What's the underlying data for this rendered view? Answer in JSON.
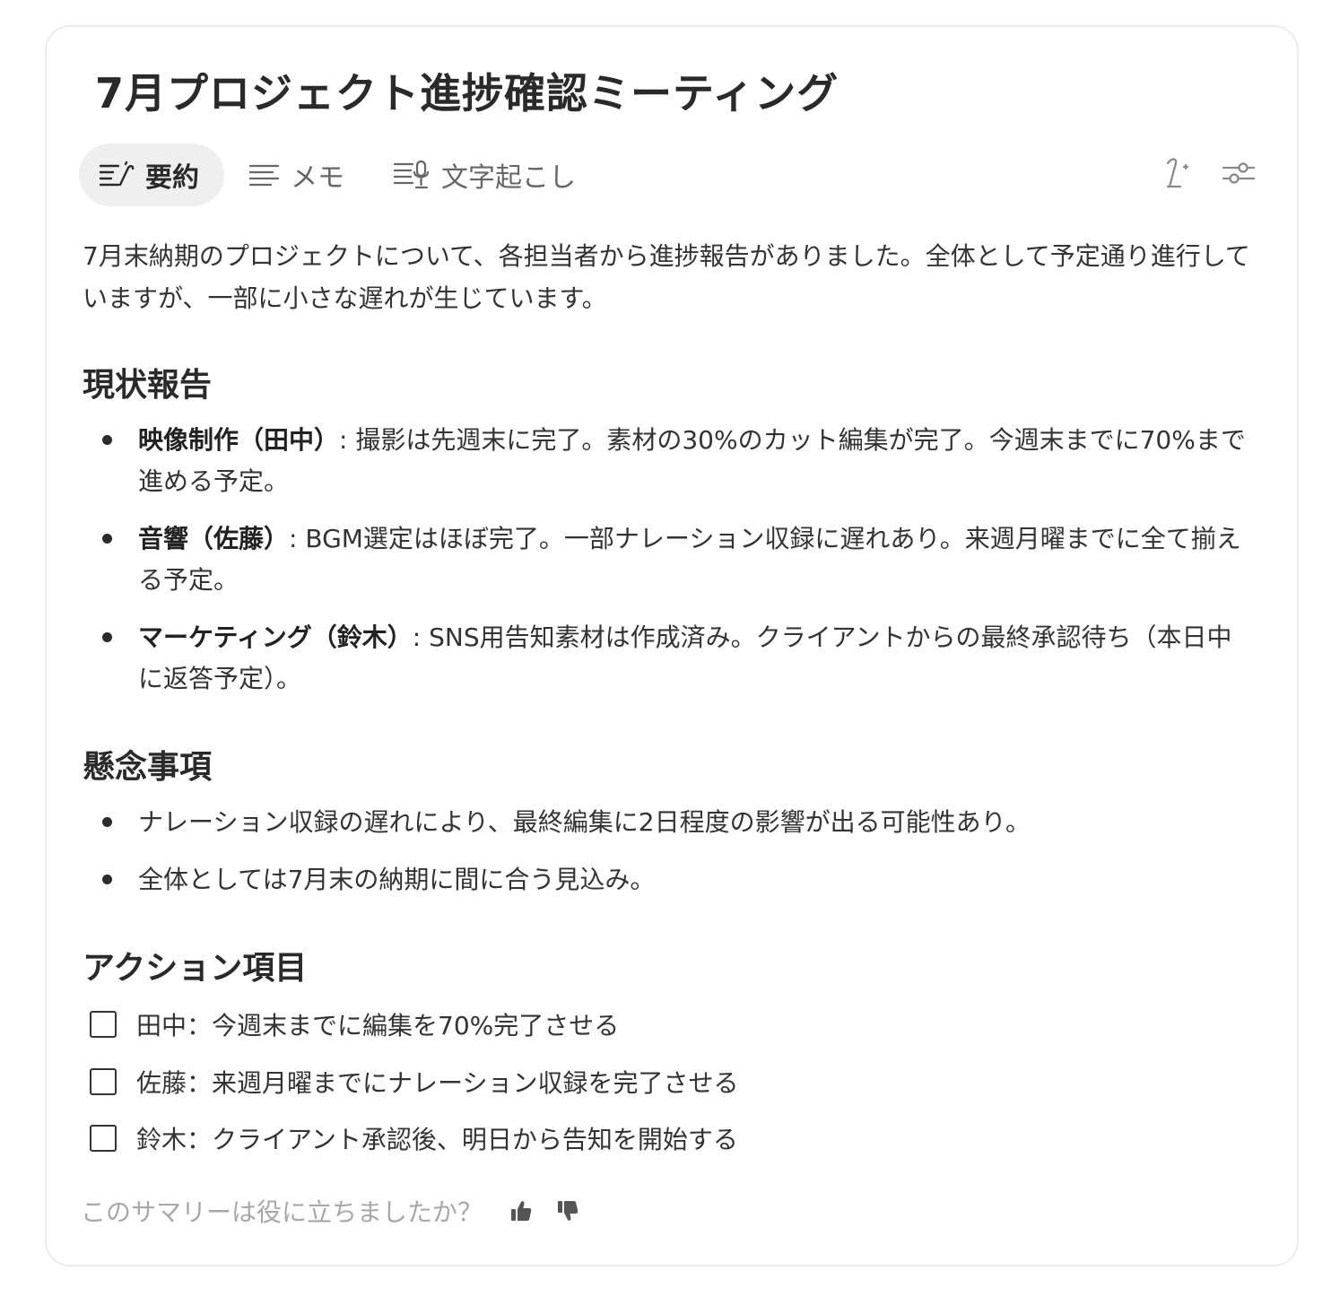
{
  "note": {
    "title": "7月プロジェクト進捗確認ミーティング"
  },
  "tabs": [
    {
      "label": "要約",
      "icon": "summary-pen-icon",
      "active": true
    },
    {
      "label": "メモ",
      "icon": "lines-icon",
      "active": false
    },
    {
      "label": "文字起こし",
      "icon": "transcript-mic-icon",
      "active": false
    }
  ],
  "toolbar": {
    "icons": [
      "regenerate-pen-icon",
      "sliders-icon"
    ]
  },
  "summary": {
    "intro": "7月末納期のプロジェクトについて、各担当者から進捗報告がありました。全体として予定通り進行していますが、一部に小さな遅れが生じています。",
    "sections": {
      "status": {
        "heading": "現状報告",
        "items": [
          {
            "label": "映像制作（田中）",
            "text": ": 撮影は先週末に完了。素材の30%のカット編集が完了。今週末までに70%まで進める予定。"
          },
          {
            "label": "音響（佐藤）",
            "text": ": BGM選定はほぼ完了。一部ナレーション収録に遅れあり。来週月曜までに全て揃える予定。"
          },
          {
            "label": "マーケティング（鈴木）",
            "text": ": SNS用告知素材は作成済み。クライアントからの最終承認待ち（本日中に返答予定）。"
          }
        ]
      },
      "concerns": {
        "heading": "懸念事項",
        "items": [
          "ナレーション収録の遅れにより、最終編集に2日程度の影響が出る可能性あり。",
          "全体としては7月末の納期に間に合う見込み。"
        ]
      },
      "actions": {
        "heading": "アクション項目",
        "tasks": [
          {
            "text": "田中：今週末までに編集を70%完了させる",
            "checked": false
          },
          {
            "text": "佐藤：来週月曜までにナレーション収録を完了させる",
            "checked": false
          },
          {
            "text": "鈴木：クライアント承認後、明日から告知を開始する",
            "checked": false
          }
        ]
      }
    }
  },
  "feedback": {
    "question": "このサマリーは役に立ちましたか？"
  }
}
